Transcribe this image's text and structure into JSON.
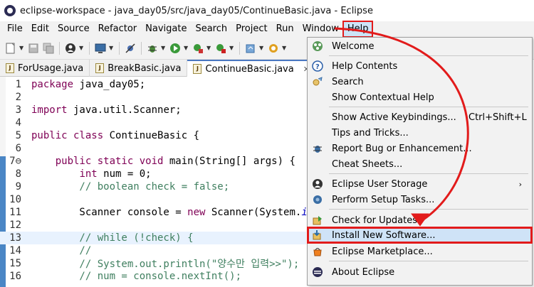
{
  "window": {
    "title": "eclipse-workspace - java_day05/src/java_day05/ContinueBasic.java - Eclipse"
  },
  "menubar": {
    "items": [
      "File",
      "Edit",
      "Source",
      "Refactor",
      "Navigate",
      "Search",
      "Project",
      "Run",
      "Window",
      "Help"
    ],
    "active": "Help"
  },
  "toolbar": {
    "icons": [
      "new-icon",
      "save-icon",
      "save-all-icon",
      "profile-icon",
      "console-icon",
      "skip-breakpoints-icon",
      "debug-icon",
      "run-icon",
      "coverage-icon",
      "external-tools-icon",
      "new-java-class-icon",
      "open-type-icon"
    ]
  },
  "tabs": [
    {
      "label": "ForUsage.java",
      "active": false
    },
    {
      "label": "BreakBasic.java",
      "active": false
    },
    {
      "label": "ContinueBasic.java",
      "active": true,
      "close": "✕"
    }
  ],
  "editor": {
    "lines": [
      {
        "n": "1",
        "code": "package java_day05;"
      },
      {
        "n": "2",
        "code": ""
      },
      {
        "n": "3",
        "code": "import java.util.Scanner;"
      },
      {
        "n": "4",
        "code": ""
      },
      {
        "n": "5",
        "code": "public class ContinueBasic {"
      },
      {
        "n": "6",
        "code": ""
      },
      {
        "n": "7⊖",
        "code": "    public static void main(String[] args) {"
      },
      {
        "n": "8",
        "code": "        int num = 0;"
      },
      {
        "n": "9",
        "code": "        // boolean check = false;"
      },
      {
        "n": "10",
        "code": ""
      },
      {
        "n": "11",
        "code": "        Scanner console = new Scanner(System.in)"
      },
      {
        "n": "12",
        "code": ""
      },
      {
        "n": "13",
        "code": "        // while (!check) {"
      },
      {
        "n": "14",
        "code": "        //"
      },
      {
        "n": "15",
        "code": "        // System.out.println(\"양수만 입력>>\");"
      },
      {
        "n": "16",
        "code": "        // num = console.nextInt();"
      }
    ]
  },
  "help_menu": {
    "items": [
      {
        "label": "Welcome",
        "icon": "welcome-icon"
      },
      {
        "label": "Help Contents",
        "icon": "help-icon"
      },
      {
        "label": "Search",
        "icon": "search-help-icon"
      },
      {
        "label": "Show Contextual Help",
        "icon": ""
      },
      {
        "label": "Show Active Keybindings...",
        "accelerator": "Ctrl+Shift+L",
        "icon": ""
      },
      {
        "label": "Tips and Tricks...",
        "icon": ""
      },
      {
        "label": "Report Bug or Enhancement...",
        "icon": "bug-icon"
      },
      {
        "label": "Cheat Sheets...",
        "icon": ""
      },
      {
        "label": "Eclipse User Storage",
        "icon": "user-storage-icon",
        "submenu": "›"
      },
      {
        "label": "Perform Setup Tasks...",
        "icon": "setup-icon"
      },
      {
        "label": "Check for Updates",
        "icon": "updates-icon"
      },
      {
        "label": "Install New Software...",
        "icon": "install-icon",
        "selected": true
      },
      {
        "label": "Eclipse Marketplace...",
        "icon": "marketplace-icon"
      },
      {
        "label": "About Eclipse",
        "icon": "about-icon"
      }
    ]
  },
  "colors": {
    "highlight": "#e21b1b",
    "selection": "#cfe3f7",
    "keyword": "#7f0055",
    "comment": "#3f7f5f",
    "string": "#2a00ff"
  }
}
